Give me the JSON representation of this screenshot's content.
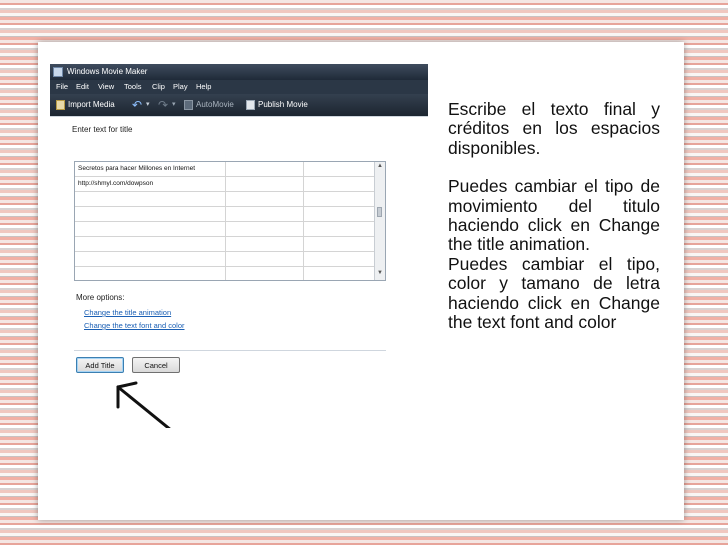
{
  "app": {
    "title": "Windows Movie Maker"
  },
  "menu": [
    "File",
    "Edit",
    "View",
    "Tools",
    "Clip",
    "Play",
    "Help"
  ],
  "toolbar": {
    "import_media": "Import Media",
    "auto_movie": "AutoMovie",
    "publish_movie": "Publish Movie"
  },
  "editor": {
    "prompt": "Enter text for title",
    "line1": "Secretos para hacer Millones en Internet",
    "line2": "http://shmyl.com/dowpson",
    "more_options": "More options:",
    "link_animation": "Change the title animation",
    "link_font": "Change the text font and color",
    "add_title": "Add Title",
    "cancel": "Cancel"
  },
  "notes": {
    "p1": "Escribe el texto final y créditos en los espacios disponibles.",
    "p2": "Puedes cambiar el tipo de movimiento del titulo haciendo click en Change the title animation.",
    "p3": "Puedes cambiar el tipo, color y tamano de letra haciendo click en Change the text font and color"
  },
  "colors": {
    "accent": "#1a5fb4",
    "titlebar": "#2b3746"
  }
}
